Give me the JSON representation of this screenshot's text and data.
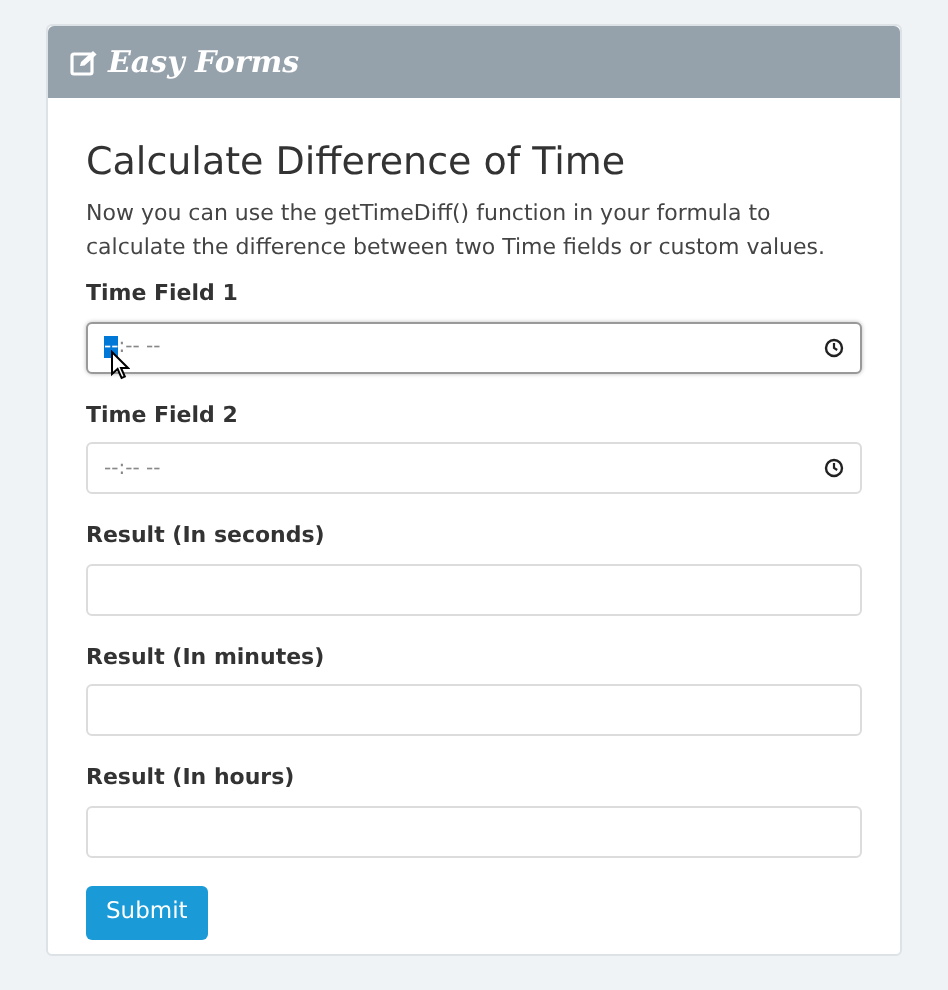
{
  "header": {
    "title": "Easy Forms"
  },
  "heading": "Calculate Difference of Time",
  "description": "Now you can use the getTimeDiff() function in your formula to calculate the difference between two Time fields or custom values.",
  "fields": [
    {
      "label": "Time Field 1",
      "kind": "time",
      "placeholder": "--:-- --",
      "focused": true
    },
    {
      "label": "Time Field 2",
      "kind": "time",
      "placeholder": "--:-- --",
      "focused": false
    },
    {
      "label": "Result (In seconds)",
      "kind": "text",
      "focused": false
    },
    {
      "label": "Result (In minutes)",
      "kind": "text",
      "focused": false
    },
    {
      "label": "Result (In hours)",
      "kind": "text",
      "focused": false
    }
  ],
  "submit": "Submit"
}
